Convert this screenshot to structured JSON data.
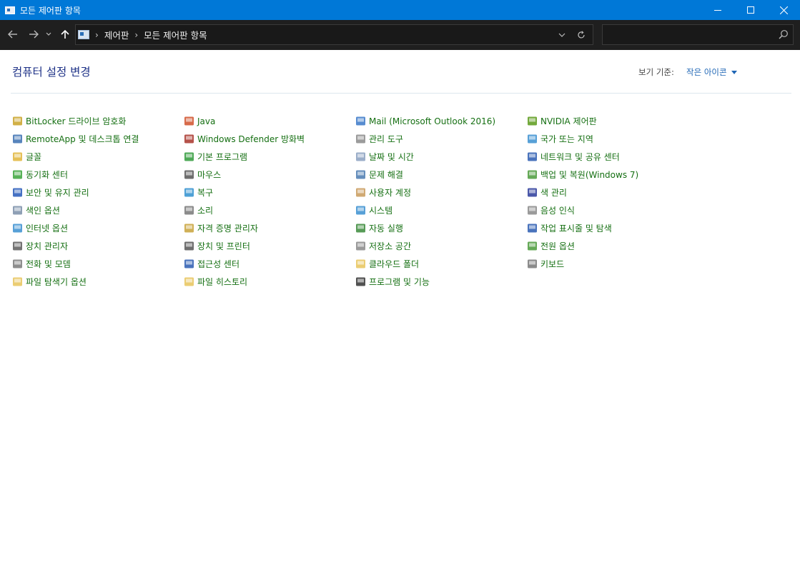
{
  "window": {
    "title": "모든 제어판 항목"
  },
  "address": {
    "crumbs": [
      "제어판",
      "모든 제어판 항목"
    ],
    "search_placeholder": ""
  },
  "header": {
    "title": "컴퓨터 설정 변경",
    "view_by_label": "보기 기준:",
    "view_by_value": "작은 아이콘"
  },
  "columns": [
    [
      {
        "label": "BitLocker 드라이브 암호화",
        "icon": "bitlocker-icon",
        "color": "#c9a227"
      },
      {
        "label": "RemoteApp 및 데스크톱 연결",
        "icon": "remoteapp-icon",
        "color": "#3a6fb0"
      },
      {
        "label": "글꼴",
        "icon": "fonts-icon",
        "color": "#e0b53a"
      },
      {
        "label": "동기화 센터",
        "icon": "sync-center-icon",
        "color": "#3aa43a"
      },
      {
        "label": "보안 및 유지 관리",
        "icon": "flag-icon",
        "color": "#2458b8"
      },
      {
        "label": "색인 옵션",
        "icon": "indexing-icon",
        "color": "#7a8ea8"
      },
      {
        "label": "인터넷 옵션",
        "icon": "internet-options-icon",
        "color": "#3a8fd0"
      },
      {
        "label": "장치 관리자",
        "icon": "device-manager-icon",
        "color": "#5a5a5a"
      },
      {
        "label": "전화 및 모뎀",
        "icon": "phone-modem-icon",
        "color": "#7a7a7a"
      },
      {
        "label": "파일 탐색기 옵션",
        "icon": "folder-options-icon",
        "color": "#e8c45a"
      }
    ],
    [
      {
        "label": "Java",
        "icon": "java-icon",
        "color": "#d0502a"
      },
      {
        "label": "Windows Defender 방화벽",
        "icon": "firewall-icon",
        "color": "#a8342a"
      },
      {
        "label": "기본 프로그램",
        "icon": "default-programs-icon",
        "color": "#2f9a3a"
      },
      {
        "label": "마우스",
        "icon": "mouse-icon",
        "color": "#555555"
      },
      {
        "label": "복구",
        "icon": "recovery-icon",
        "color": "#2f8fcf"
      },
      {
        "label": "소리",
        "icon": "sound-icon",
        "color": "#777777"
      },
      {
        "label": "자격 증명 관리자",
        "icon": "credential-manager-icon",
        "color": "#c8a23a"
      },
      {
        "label": "장치 및 프린터",
        "icon": "devices-printers-icon",
        "color": "#555555"
      },
      {
        "label": "접근성 센터",
        "icon": "ease-of-access-icon",
        "color": "#2a5ab0"
      },
      {
        "label": "파일 히스토리",
        "icon": "file-history-icon",
        "color": "#e8c45a"
      }
    ],
    [
      {
        "label": "Mail (Microsoft Outlook 2016)",
        "icon": "mail-icon",
        "color": "#3a78c8"
      },
      {
        "label": "관리 도구",
        "icon": "admin-tools-icon",
        "color": "#8a8a8a"
      },
      {
        "label": "날짜 및 시간",
        "icon": "date-time-icon",
        "color": "#8aa0c0"
      },
      {
        "label": "문제 해결",
        "icon": "troubleshooting-icon",
        "color": "#4a7ab0"
      },
      {
        "label": "사용자 계정",
        "icon": "user-accounts-icon",
        "color": "#c89a5a"
      },
      {
        "label": "시스템",
        "icon": "system-icon",
        "color": "#3a8fd0"
      },
      {
        "label": "자동 실행",
        "icon": "autoplay-icon",
        "color": "#3a8a3a"
      },
      {
        "label": "저장소 공간",
        "icon": "storage-spaces-icon",
        "color": "#888888"
      },
      {
        "label": "클라우드 폴더",
        "icon": "cloud-folder-icon",
        "color": "#e8c45a"
      },
      {
        "label": "프로그램 및 기능",
        "icon": "programs-features-icon",
        "color": "#333333"
      }
    ],
    [
      {
        "label": "NVIDIA 제어판",
        "icon": "nvidia-icon",
        "color": "#5a9a1a"
      },
      {
        "label": "국가 또는 지역",
        "icon": "region-icon",
        "color": "#3a8fd0"
      },
      {
        "label": "네트워크 및 공유 센터",
        "icon": "network-icon",
        "color": "#2a5ab0"
      },
      {
        "label": "백업 및 복원(Windows 7)",
        "icon": "backup-restore-icon",
        "color": "#4a9a3a"
      },
      {
        "label": "색 관리",
        "icon": "color-management-icon",
        "color": "#2a3a9a"
      },
      {
        "label": "음성 인식",
        "icon": "microphone-icon",
        "color": "#888888"
      },
      {
        "label": "작업 표시줄 및 탐색",
        "icon": "taskbar-icon",
        "color": "#2a5ab0"
      },
      {
        "label": "전원 옵션",
        "icon": "power-options-icon",
        "color": "#4a9a3a"
      },
      {
        "label": "키보드",
        "icon": "keyboard-icon",
        "color": "#777777"
      }
    ]
  ]
}
